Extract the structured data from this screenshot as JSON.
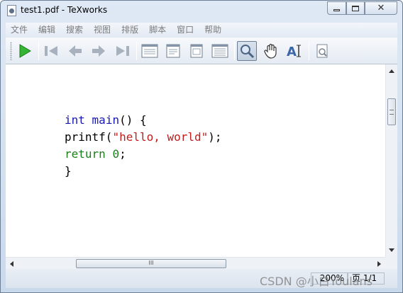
{
  "window": {
    "title": "test1.pdf - TeXworks"
  },
  "menu": [
    "文件",
    "编辑",
    "搜索",
    "视图",
    "排版",
    "脚本",
    "窗口",
    "帮助"
  ],
  "toolbar": {
    "icons": [
      "typeset-run-icon",
      "first-page-icon",
      "previous-page-icon",
      "next-page-icon",
      "last-page-icon",
      "actual-size-icon",
      "fit-width-icon",
      "fit-window-icon",
      "continuous-scroll-icon",
      "magnifier-icon",
      "hand-icon",
      "text-select-icon",
      "page-preview-icon"
    ]
  },
  "document": {
    "code_lines": [
      {
        "parts": [
          {
            "text": "int",
            "style": "kw-blue"
          },
          {
            "text": " "
          },
          {
            "text": "main",
            "style": "kw-blue"
          },
          {
            "text": "() {"
          }
        ]
      },
      {
        "parts": [
          {
            "text": "printf("
          },
          {
            "text": "\"hello, world\"",
            "style": "str"
          },
          {
            "text": ");"
          }
        ]
      },
      {
        "parts": [
          {
            "text": "return",
            "style": "kw-green"
          },
          {
            "text": " "
          },
          {
            "text": "0",
            "style": "num"
          },
          {
            "text": ";"
          }
        ]
      },
      {
        "parts": [
          {
            "text": "}"
          }
        ]
      }
    ]
  },
  "scrollbar": {
    "h_thumb_glyph": "III"
  },
  "status": {
    "zoom": "200%",
    "page": "页 1/1"
  },
  "watermark": "CSDN @小白Youlans"
}
